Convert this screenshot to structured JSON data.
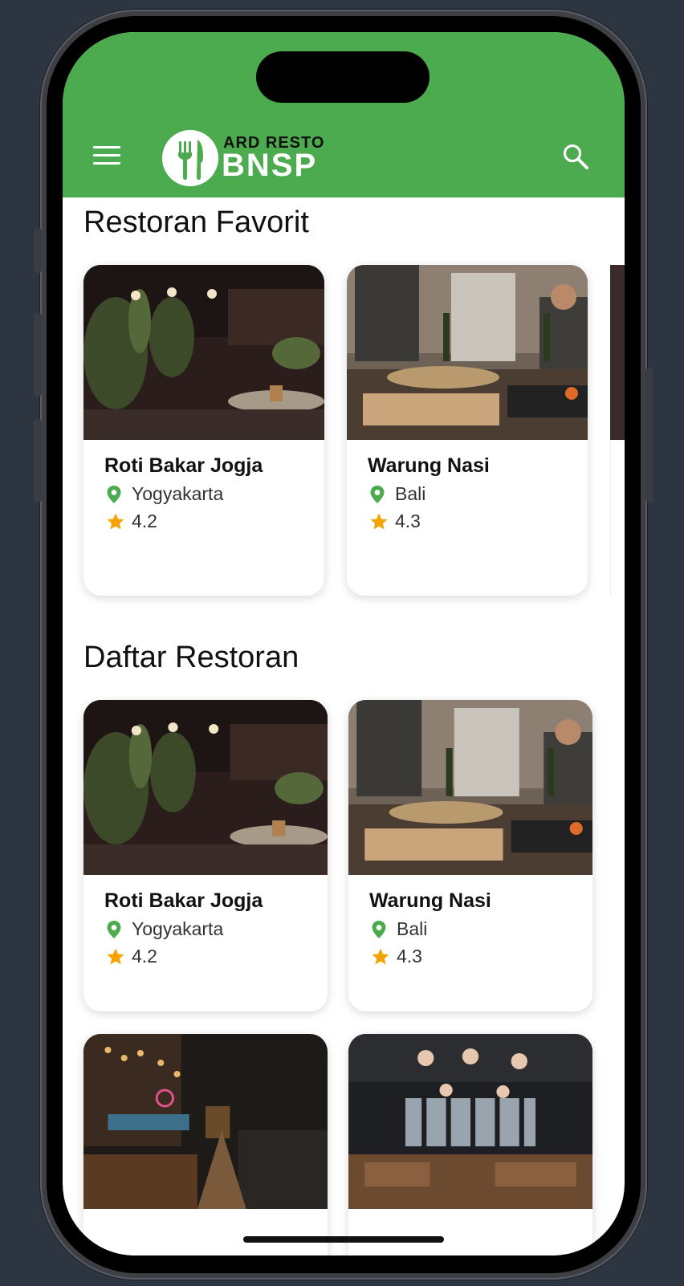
{
  "app": {
    "logo_top": "ARD RESTO",
    "logo_main": "BNSP",
    "accent_color": "#4caa4f",
    "icons": {
      "menu": "menu-icon",
      "search": "search-icon",
      "location": "location-pin-icon",
      "rating": "star-icon"
    }
  },
  "favorites": {
    "title": "Restoran Favorit",
    "items": [
      {
        "name": "Roti Bakar Jogja",
        "city": "Yogyakarta",
        "rating": "4.2"
      },
      {
        "name": "Warung Nasi",
        "city": "Bali",
        "rating": "4.3"
      }
    ]
  },
  "list": {
    "title": "Daftar Restoran",
    "items": [
      {
        "name": "Roti Bakar Jogja",
        "city": "Yogyakarta",
        "rating": "4.2"
      },
      {
        "name": "Warung Nasi",
        "city": "Bali",
        "rating": "4.3"
      },
      {
        "name": "",
        "city": "",
        "rating": ""
      },
      {
        "name": "",
        "city": "",
        "rating": ""
      }
    ]
  }
}
